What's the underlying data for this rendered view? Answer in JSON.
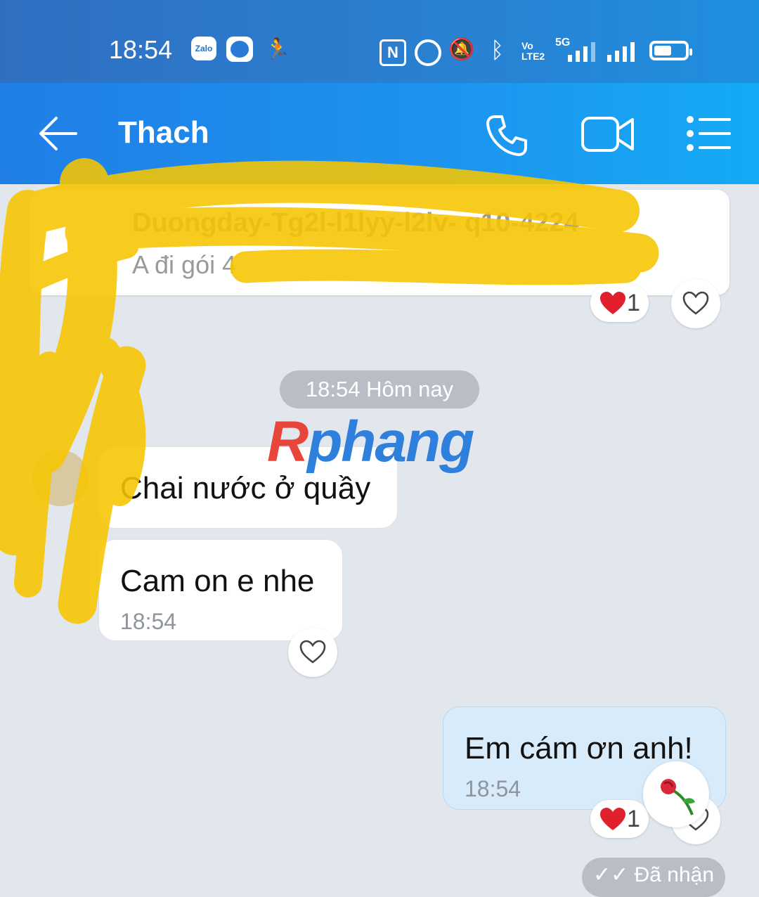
{
  "status_bar": {
    "time": "18:54",
    "zalo_label": "Zalo",
    "volte": "Vo LTE2",
    "network": "5G"
  },
  "header": {
    "contact_name": "Thach"
  },
  "card": {
    "title": "Duongday-Tg2l-l1lyy-l2lv- q10-4224",
    "subtitle": "A đi gói 4",
    "reaction_count": "1"
  },
  "date_chip": "18:54 Hôm nay",
  "watermark": {
    "first": "R",
    "rest": "phang"
  },
  "messages": [
    {
      "text": "Chai nước ở quầy",
      "time": ""
    },
    {
      "text": "Cam on e nhe",
      "time": "18:54"
    },
    {
      "text": "Em cám ơn anh!",
      "time": "18:54",
      "reaction_count": "1"
    }
  ],
  "seen_label": "✓✓ Đã nhận",
  "colors": {
    "header_start": "#1f7fe6",
    "header_end": "#14aaf5",
    "status_bar": "#2b7fd0",
    "chat_bg": "#e2e7ee",
    "outgoing_bubble": "#d7ebfb",
    "heart_red": "#e0202c",
    "scribble_yellow": "#f7c600"
  },
  "icons": [
    "back-arrow-icon",
    "phone-icon",
    "video-camera-icon",
    "menu-list-icon",
    "heart-icon",
    "heart-outline-icon",
    "rose-sticker-icon",
    "nfc-icon",
    "alarm-icon",
    "mute-icon",
    "bluetooth-icon",
    "battery-icon"
  ]
}
